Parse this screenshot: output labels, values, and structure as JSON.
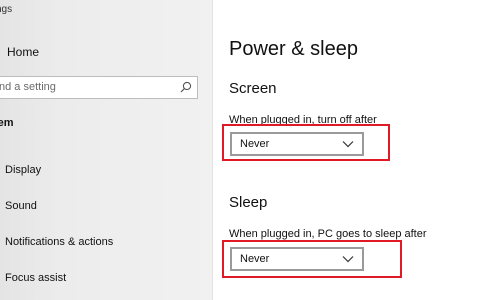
{
  "window": {
    "title": "ngs"
  },
  "sidebar": {
    "home_label": "Home",
    "search": {
      "placeholder": "nd a setting"
    },
    "section_label": "tem",
    "items": [
      {
        "label": "Display",
        "icon": "display-icon"
      },
      {
        "label": "Sound",
        "icon": "sound-icon"
      },
      {
        "label": "Notifications & actions",
        "icon": "notifications-icon"
      },
      {
        "label": "Focus assist",
        "icon": "focus-assist-icon"
      }
    ]
  },
  "main": {
    "title": "Power & sleep",
    "screen": {
      "heading": "Screen",
      "label": "When plugged in, turn off after",
      "value": "Never"
    },
    "sleep": {
      "heading": "Sleep",
      "label": "When plugged in, PC goes to sleep after",
      "value": "Never"
    }
  },
  "colors": {
    "highlight": "#e01a24",
    "sidebar_bg": "#efefef"
  }
}
